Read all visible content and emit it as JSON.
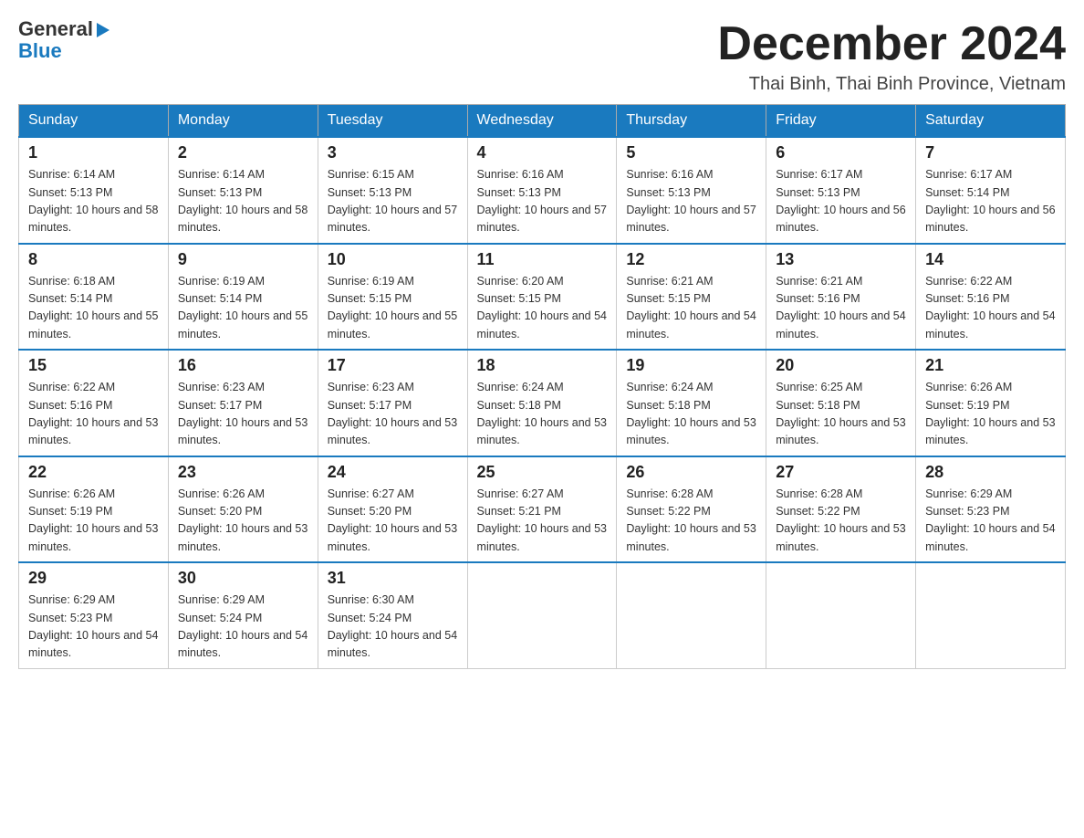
{
  "header": {
    "logo_general": "General",
    "logo_blue": "Blue",
    "month_title": "December 2024",
    "location": "Thai Binh, Thai Binh Province, Vietnam"
  },
  "days_of_week": [
    "Sunday",
    "Monday",
    "Tuesday",
    "Wednesday",
    "Thursday",
    "Friday",
    "Saturday"
  ],
  "weeks": [
    [
      {
        "day": "1",
        "sunrise": "6:14 AM",
        "sunset": "5:13 PM",
        "daylight": "10 hours and 58 minutes."
      },
      {
        "day": "2",
        "sunrise": "6:14 AM",
        "sunset": "5:13 PM",
        "daylight": "10 hours and 58 minutes."
      },
      {
        "day": "3",
        "sunrise": "6:15 AM",
        "sunset": "5:13 PM",
        "daylight": "10 hours and 57 minutes."
      },
      {
        "day": "4",
        "sunrise": "6:16 AM",
        "sunset": "5:13 PM",
        "daylight": "10 hours and 57 minutes."
      },
      {
        "day": "5",
        "sunrise": "6:16 AM",
        "sunset": "5:13 PM",
        "daylight": "10 hours and 57 minutes."
      },
      {
        "day": "6",
        "sunrise": "6:17 AM",
        "sunset": "5:13 PM",
        "daylight": "10 hours and 56 minutes."
      },
      {
        "day": "7",
        "sunrise": "6:17 AM",
        "sunset": "5:14 PM",
        "daylight": "10 hours and 56 minutes."
      }
    ],
    [
      {
        "day": "8",
        "sunrise": "6:18 AM",
        "sunset": "5:14 PM",
        "daylight": "10 hours and 55 minutes."
      },
      {
        "day": "9",
        "sunrise": "6:19 AM",
        "sunset": "5:14 PM",
        "daylight": "10 hours and 55 minutes."
      },
      {
        "day": "10",
        "sunrise": "6:19 AM",
        "sunset": "5:15 PM",
        "daylight": "10 hours and 55 minutes."
      },
      {
        "day": "11",
        "sunrise": "6:20 AM",
        "sunset": "5:15 PM",
        "daylight": "10 hours and 54 minutes."
      },
      {
        "day": "12",
        "sunrise": "6:21 AM",
        "sunset": "5:15 PM",
        "daylight": "10 hours and 54 minutes."
      },
      {
        "day": "13",
        "sunrise": "6:21 AM",
        "sunset": "5:16 PM",
        "daylight": "10 hours and 54 minutes."
      },
      {
        "day": "14",
        "sunrise": "6:22 AM",
        "sunset": "5:16 PM",
        "daylight": "10 hours and 54 minutes."
      }
    ],
    [
      {
        "day": "15",
        "sunrise": "6:22 AM",
        "sunset": "5:16 PM",
        "daylight": "10 hours and 53 minutes."
      },
      {
        "day": "16",
        "sunrise": "6:23 AM",
        "sunset": "5:17 PM",
        "daylight": "10 hours and 53 minutes."
      },
      {
        "day": "17",
        "sunrise": "6:23 AM",
        "sunset": "5:17 PM",
        "daylight": "10 hours and 53 minutes."
      },
      {
        "day": "18",
        "sunrise": "6:24 AM",
        "sunset": "5:18 PM",
        "daylight": "10 hours and 53 minutes."
      },
      {
        "day": "19",
        "sunrise": "6:24 AM",
        "sunset": "5:18 PM",
        "daylight": "10 hours and 53 minutes."
      },
      {
        "day": "20",
        "sunrise": "6:25 AM",
        "sunset": "5:18 PM",
        "daylight": "10 hours and 53 minutes."
      },
      {
        "day": "21",
        "sunrise": "6:26 AM",
        "sunset": "5:19 PM",
        "daylight": "10 hours and 53 minutes."
      }
    ],
    [
      {
        "day": "22",
        "sunrise": "6:26 AM",
        "sunset": "5:19 PM",
        "daylight": "10 hours and 53 minutes."
      },
      {
        "day": "23",
        "sunrise": "6:26 AM",
        "sunset": "5:20 PM",
        "daylight": "10 hours and 53 minutes."
      },
      {
        "day": "24",
        "sunrise": "6:27 AM",
        "sunset": "5:20 PM",
        "daylight": "10 hours and 53 minutes."
      },
      {
        "day": "25",
        "sunrise": "6:27 AM",
        "sunset": "5:21 PM",
        "daylight": "10 hours and 53 minutes."
      },
      {
        "day": "26",
        "sunrise": "6:28 AM",
        "sunset": "5:22 PM",
        "daylight": "10 hours and 53 minutes."
      },
      {
        "day": "27",
        "sunrise": "6:28 AM",
        "sunset": "5:22 PM",
        "daylight": "10 hours and 53 minutes."
      },
      {
        "day": "28",
        "sunrise": "6:29 AM",
        "sunset": "5:23 PM",
        "daylight": "10 hours and 54 minutes."
      }
    ],
    [
      {
        "day": "29",
        "sunrise": "6:29 AM",
        "sunset": "5:23 PM",
        "daylight": "10 hours and 54 minutes."
      },
      {
        "day": "30",
        "sunrise": "6:29 AM",
        "sunset": "5:24 PM",
        "daylight": "10 hours and 54 minutes."
      },
      {
        "day": "31",
        "sunrise": "6:30 AM",
        "sunset": "5:24 PM",
        "daylight": "10 hours and 54 minutes."
      },
      null,
      null,
      null,
      null
    ]
  ]
}
